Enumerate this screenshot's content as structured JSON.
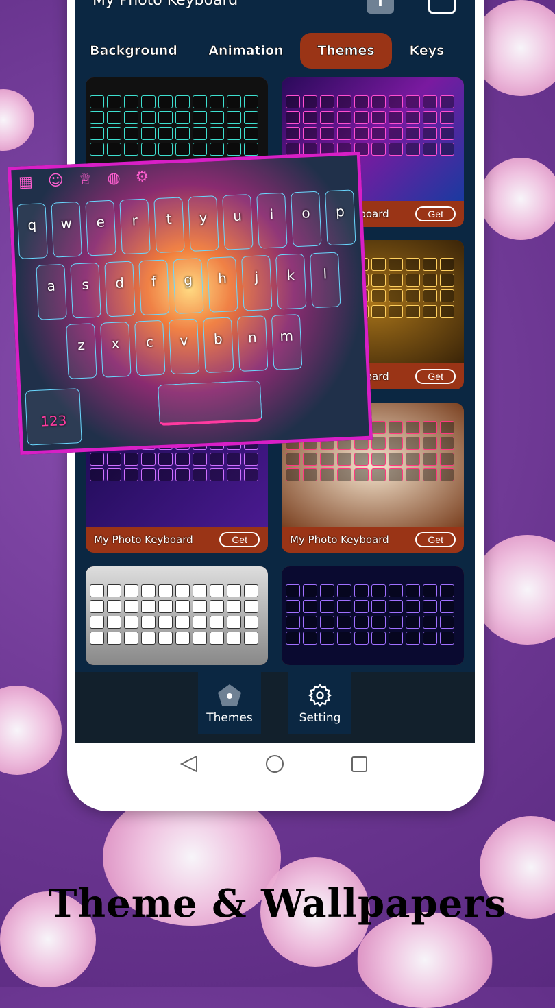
{
  "app": {
    "title": "My Photo Keyboard"
  },
  "tabs": [
    {
      "label": "Background"
    },
    {
      "label": "Animation"
    },
    {
      "label": "Themes",
      "active": true
    },
    {
      "label": "Keys"
    }
  ],
  "cards": [
    {
      "theme": "dark-teal-hex",
      "label": "",
      "get": ""
    },
    {
      "theme": "neon-purple",
      "label": "My Photo Keyboard",
      "get": "Get"
    },
    {
      "theme": "butterfly",
      "label": "",
      "get": ""
    },
    {
      "theme": "gold-glitter",
      "label": "My Photo Keyboard",
      "get": "Get"
    },
    {
      "theme": "neon-ring",
      "label": "My Photo Keyboard",
      "get": "Get"
    },
    {
      "theme": "red-bow",
      "label": "My Photo Keyboard",
      "get": "Get"
    },
    {
      "theme": "silver-glitter",
      "label": "",
      "get": ""
    },
    {
      "theme": "neon-heart-hand",
      "label": "",
      "get": ""
    }
  ],
  "preview": {
    "rows": [
      [
        "q",
        "w",
        "e",
        "r",
        "t",
        "y",
        "u",
        "i",
        "o",
        "p"
      ],
      [
        "a",
        "s",
        "d",
        "f",
        "g",
        "h",
        "j",
        "k",
        "l"
      ],
      [
        "z",
        "x",
        "c",
        "v",
        "b",
        "n",
        "m"
      ]
    ],
    "num_key": "123"
  },
  "bottom_nav": [
    {
      "label": "Themes",
      "icon": "pentagon-icon"
    },
    {
      "label": "Setting",
      "icon": "gear-icon"
    }
  ],
  "caption": "Theme & Wallpapers",
  "colors": {
    "accent": "#9a3416",
    "screen": "#0b2742",
    "border": "#d81fc6"
  }
}
